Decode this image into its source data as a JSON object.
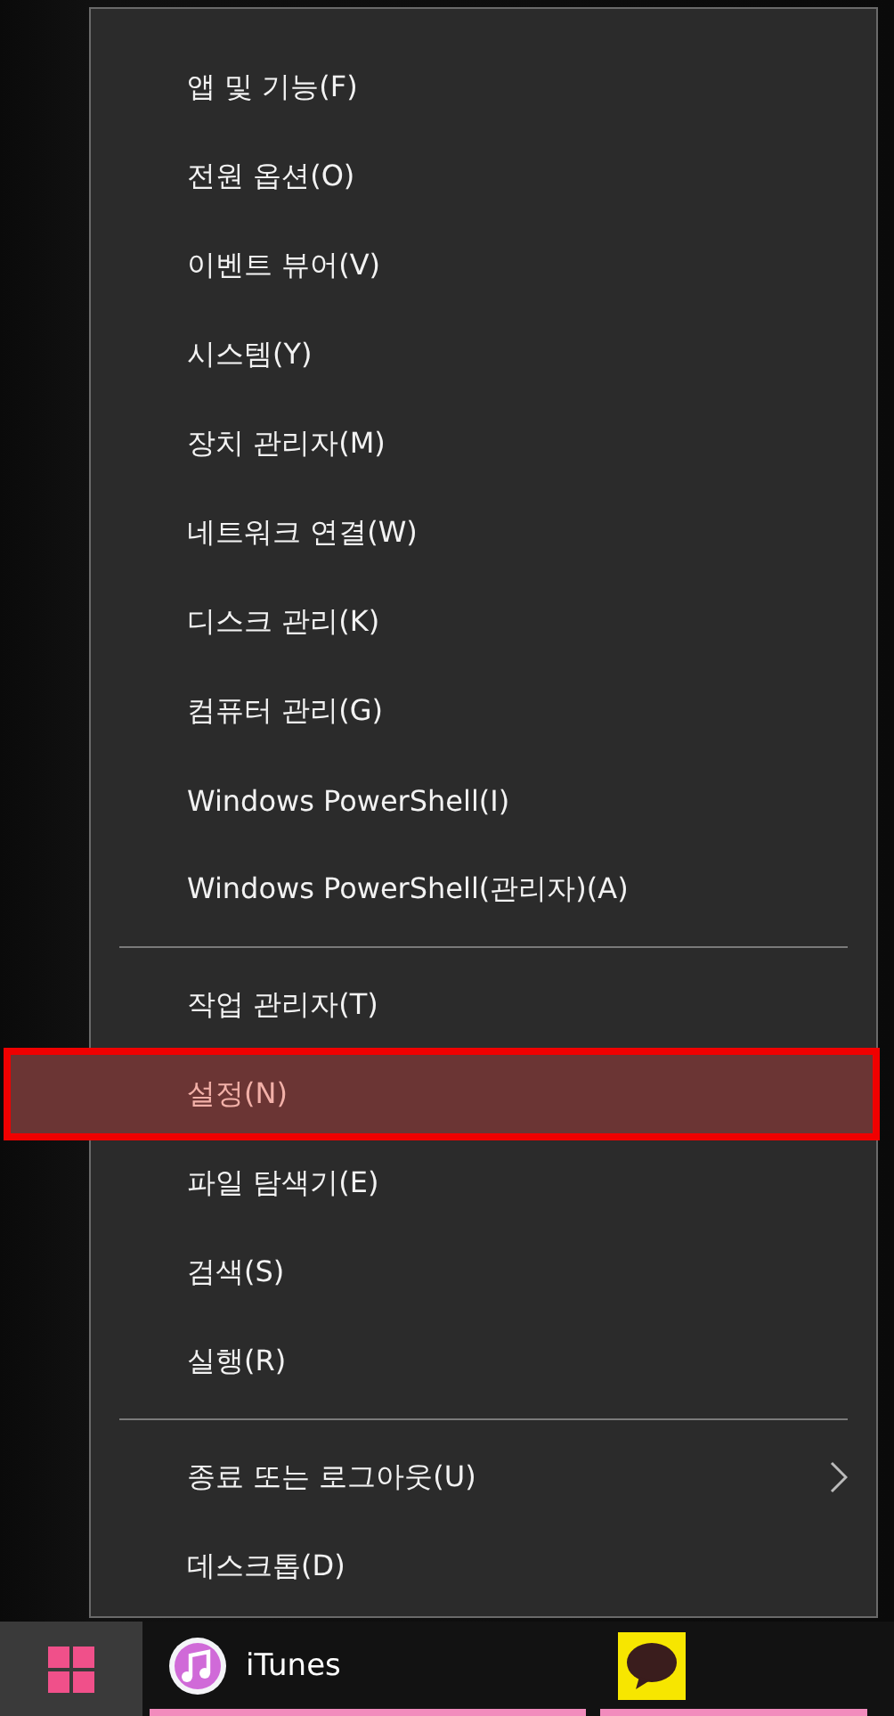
{
  "menu": {
    "groups": [
      [
        {
          "label": "앱 및 기능(F)",
          "selected": false,
          "submenu": false
        },
        {
          "label": "전원 옵션(O)",
          "selected": false,
          "submenu": false
        },
        {
          "label": "이벤트 뷰어(V)",
          "selected": false,
          "submenu": false
        },
        {
          "label": "시스템(Y)",
          "selected": false,
          "submenu": false
        },
        {
          "label": "장치 관리자(M)",
          "selected": false,
          "submenu": false
        },
        {
          "label": "네트워크 연결(W)",
          "selected": false,
          "submenu": false
        },
        {
          "label": "디스크 관리(K)",
          "selected": false,
          "submenu": false
        },
        {
          "label": "컴퓨터 관리(G)",
          "selected": false,
          "submenu": false
        },
        {
          "label": "Windows PowerShell(I)",
          "selected": false,
          "submenu": false
        },
        {
          "label": "Windows PowerShell(관리자)(A)",
          "selected": false,
          "submenu": false
        }
      ],
      [
        {
          "label": "작업 관리자(T)",
          "selected": false,
          "submenu": false
        },
        {
          "label": "설정(N)",
          "selected": true,
          "submenu": false
        },
        {
          "label": "파일 탐색기(E)",
          "selected": false,
          "submenu": false
        },
        {
          "label": "검색(S)",
          "selected": false,
          "submenu": false
        },
        {
          "label": "실행(R)",
          "selected": false,
          "submenu": false
        }
      ],
      [
        {
          "label": "종료 또는 로그아웃(U)",
          "selected": false,
          "submenu": true
        },
        {
          "label": "데스크톱(D)",
          "selected": false,
          "submenu": false
        }
      ]
    ]
  },
  "taskbar": {
    "items": [
      {
        "kind": "itunes",
        "label": "iTunes"
      },
      {
        "kind": "talk"
      }
    ]
  }
}
